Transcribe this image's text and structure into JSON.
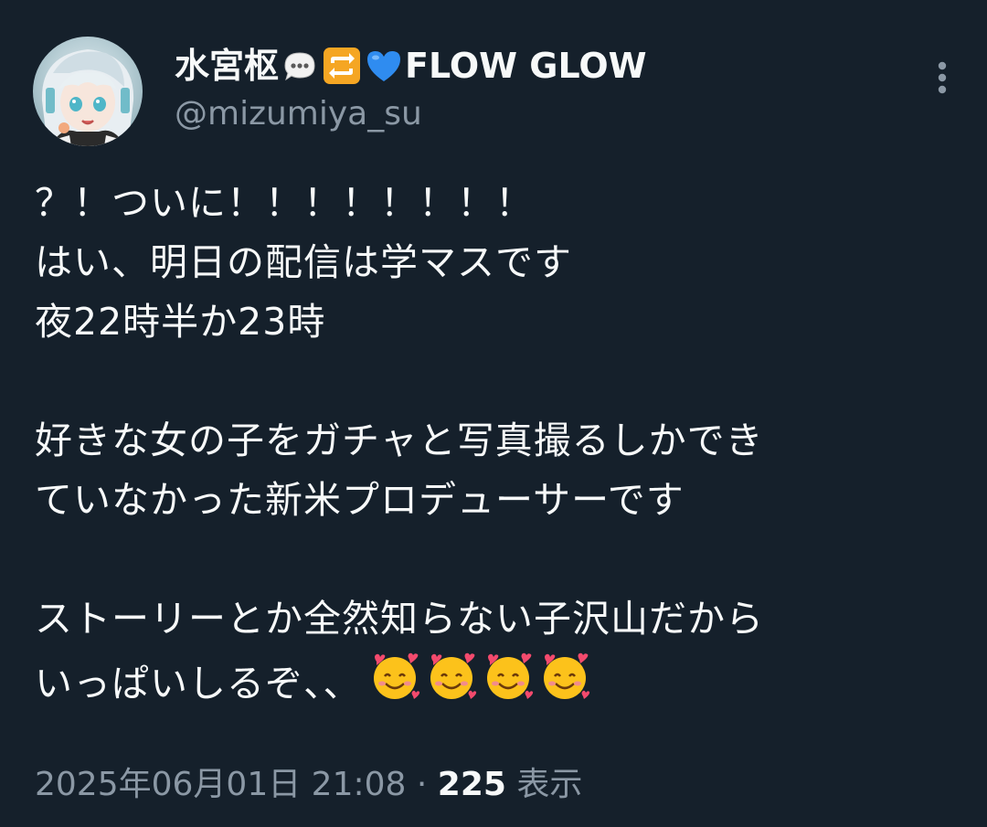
{
  "author": {
    "display_name_part1": "水宮枢",
    "display_name_part2": "FLOW GLOW",
    "handle": "@mizumiya_su",
    "name_emojis": [
      "speech-balloon-emoji",
      "repeat-emoji",
      "blue-heart-emoji"
    ]
  },
  "tweet": {
    "lines": [
      "？！ついに！！！！！！！！",
      "はい、明日の配信は学マスです",
      "夜22時半か23時",
      "",
      "好きな女の子をガチャと写真撮るしかでき",
      "ていなかった新米プロデューサーです",
      "",
      "ストーリーとか全然知らない子沢山だから",
      "いっぱいしるぞ、、"
    ],
    "trailing_emojis": [
      "smiling-face-with-hearts-emoji",
      "smiling-face-with-hearts-emoji",
      "smiling-face-with-hearts-emoji",
      "smiling-face-with-hearts-emoji"
    ]
  },
  "meta": {
    "timestamp": "2025年06月01日 21:08",
    "separator": "·",
    "view_count": "225",
    "view_label": "表示"
  },
  "colors": {
    "background": "#15202b",
    "text": "#f7f9f9",
    "secondary": "#8b98a5"
  }
}
